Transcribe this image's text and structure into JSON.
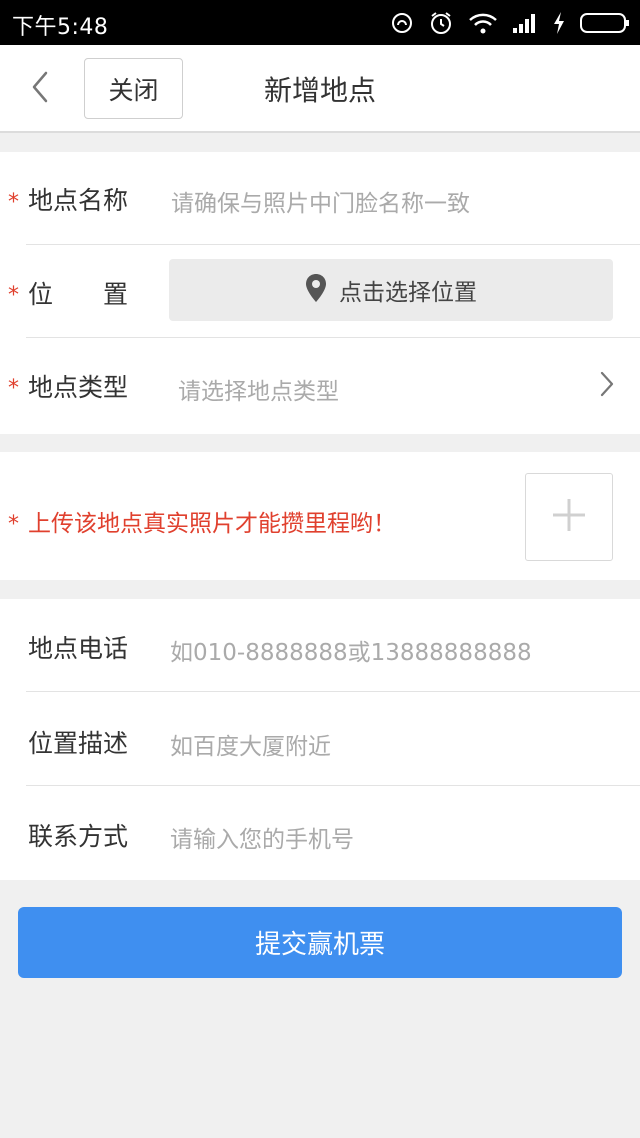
{
  "status_bar": {
    "time": "下午5:48",
    "icons": [
      "alarm-sync-icon",
      "alarm-clock-icon",
      "wifi-icon",
      "signal-icon",
      "charging-icon",
      "battery-icon"
    ]
  },
  "nav": {
    "back_icon": "chevron-left-icon",
    "close_label": "关闭",
    "title": "新增地点"
  },
  "form": {
    "required_mark": "*",
    "name": {
      "label": "地点名称",
      "placeholder": "请确保与照片中门脸名称一致"
    },
    "location": {
      "label": "位　　置",
      "button_label": "点击选择位置",
      "icon": "map-pin-icon"
    },
    "type": {
      "label": "地点类型",
      "placeholder": "请选择地点类型",
      "icon": "chevron-right-icon"
    },
    "photo": {
      "tip": "上传该地点真实照片才能攒里程哟！",
      "add_icon": "plus-icon"
    },
    "phone": {
      "label": "地点电话",
      "placeholder": "如010-8888888或13888888888"
    },
    "description": {
      "label": "位置描述",
      "placeholder": "如百度大厦附近"
    },
    "contact": {
      "label": "联系方式",
      "placeholder": "请输入您的手机号"
    }
  },
  "submit_label": "提交赢机票",
  "colors": {
    "accent": "#3f8ff0",
    "required": "#e0402e",
    "placeholder": "#aaaaaa",
    "background": "#f0f0f0"
  }
}
